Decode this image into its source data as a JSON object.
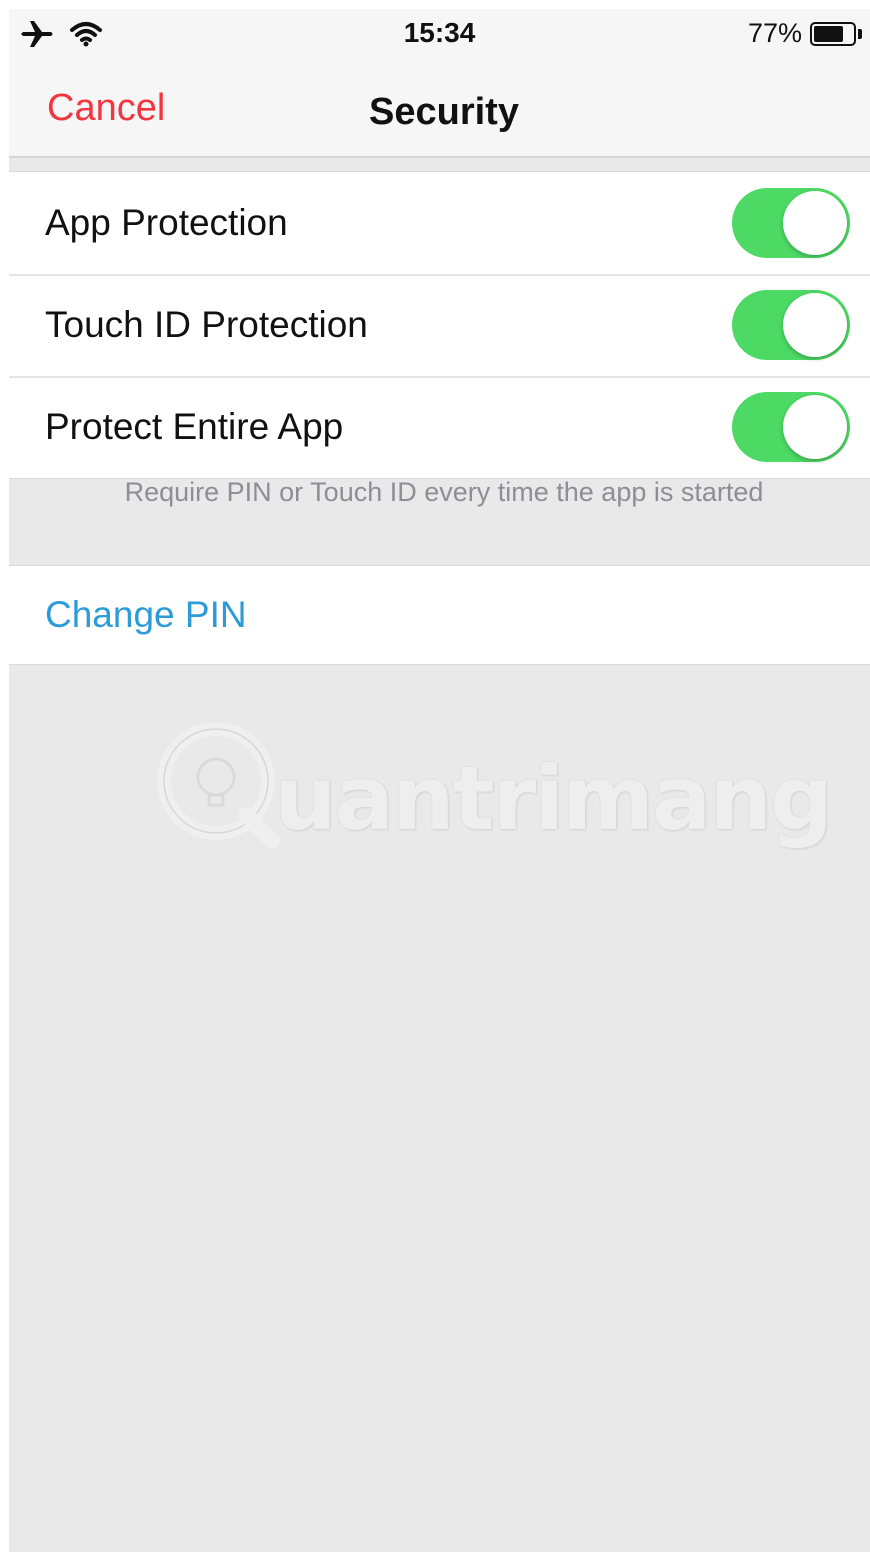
{
  "status_bar": {
    "time": "15:34",
    "battery_percent_label": "77%",
    "battery_level": 0.77,
    "icons": [
      "airplane-icon",
      "wifi-icon",
      "battery-icon"
    ]
  },
  "nav": {
    "cancel_label": "Cancel",
    "title": "Security"
  },
  "settings": {
    "rows": [
      {
        "label": "App Protection",
        "enabled": true
      },
      {
        "label": "Touch ID Protection",
        "enabled": true
      },
      {
        "label": "Protect Entire App",
        "enabled": true
      }
    ],
    "footer_note": "Require PIN or Touch ID every time the app is started"
  },
  "change_pin_label": "Change PIN",
  "watermark": {
    "text": "uantrimang"
  },
  "colors": {
    "accent_red": "#f2353f",
    "toggle_on": "#4cd964",
    "link_blue": "#2b9cd8",
    "background": "#e9e9ea"
  }
}
